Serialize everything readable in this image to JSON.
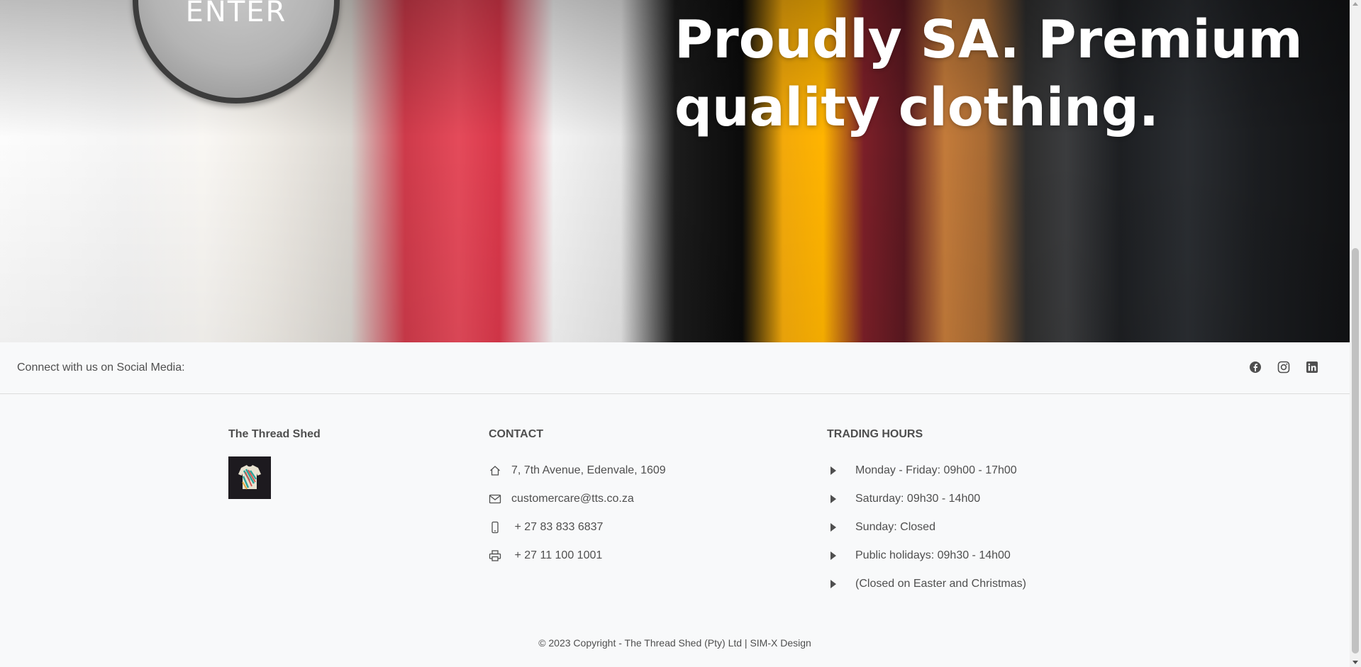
{
  "hero": {
    "enter_label": "ENTER",
    "title_line1": "Proudly SA. Premium",
    "title_line2": "quality clothing."
  },
  "social": {
    "text": "Connect with us on Social Media:",
    "icons": [
      "facebook-icon",
      "instagram-icon",
      "linkedin-icon"
    ]
  },
  "brand": {
    "title": "The Thread Shed",
    "logo_icon": "tshirt-logo"
  },
  "contact": {
    "title": "CONTACT",
    "address": "7, 7th Avenue, Edenvale, 1609",
    "email": "customercare@tts.co.za",
    "mobile": " + 27 83 833 6837",
    "fax": " + 27 11 100 1001"
  },
  "hours": {
    "title": "TRADING HOURS",
    "items": [
      "Monday - Friday: 09h00 - 17h00",
      "Saturday: 09h30 - 14h00",
      "Sunday: Closed",
      "Public holidays: 09h30 - 14h00",
      "(Closed on Easter and Christmas)"
    ]
  },
  "footer": {
    "copyright": "© 2023 Copyright - The Thread Shed (Pty) Ltd | SIM-X Design"
  },
  "colors": {
    "text": "#4f4f4f",
    "background": "#f8f9fa",
    "hero_text": "#ffffff"
  }
}
